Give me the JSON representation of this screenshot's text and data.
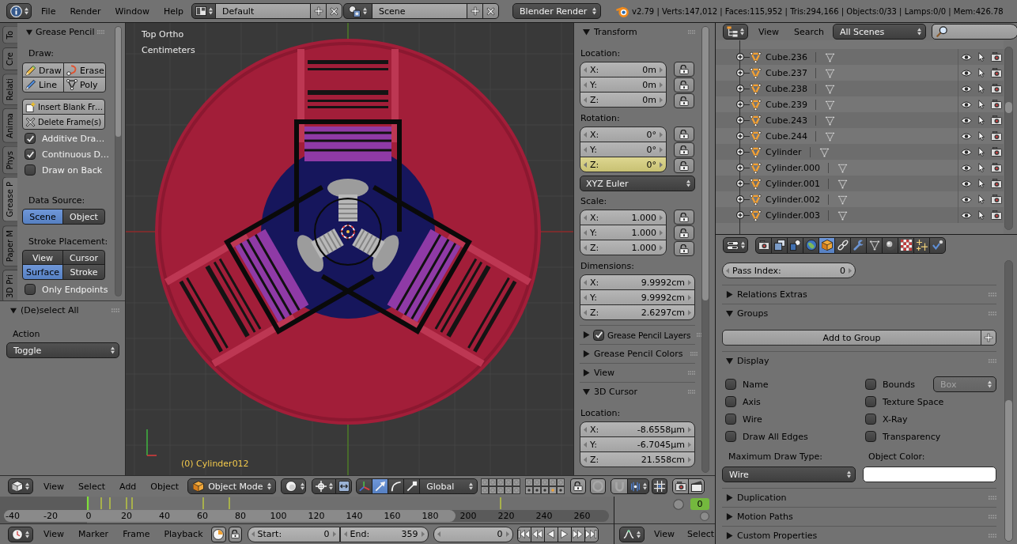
{
  "info_header": {
    "menus": [
      "File",
      "Render",
      "Window",
      "Help"
    ],
    "screen_layout": "Default",
    "scene": "Scene",
    "render_engine": "Blender Render",
    "stats": "v2.79 | Verts:147,012 | Faces:115,952 | Tris:294,166 | Objects:0/33 | Lamps:0/0 | Mem:426.78"
  },
  "tool_shelf": {
    "tabs": [
      {
        "label": "To",
        "selected": false
      },
      {
        "label": "Cre",
        "selected": false
      },
      {
        "label": "Relati",
        "selected": false
      },
      {
        "label": "Anima",
        "selected": false
      },
      {
        "label": "Phys",
        "selected": false
      },
      {
        "label": "Grease P",
        "selected": true
      },
      {
        "label": "Paper M",
        "selected": false
      },
      {
        "label": "3D Pri",
        "selected": false
      }
    ],
    "panel": {
      "title": "Grease Pencil",
      "expanded": true,
      "draw_label": "Draw:",
      "draw_tools": [
        {
          "kind": "draw",
          "label": "Draw"
        },
        {
          "kind": "erase",
          "label": "Erase"
        },
        {
          "kind": "line",
          "label": "Line"
        },
        {
          "kind": "poly",
          "label": "Poly"
        }
      ],
      "frame_actions": [
        {
          "kind": "insert",
          "label": "Insert Blank Fr…"
        },
        {
          "kind": "delete",
          "label": "Delete Frame(s)"
        }
      ],
      "options": [
        {
          "label": "Additive Dra…",
          "checked": true
        },
        {
          "label": "Continuous D…",
          "checked": true
        },
        {
          "label": "Draw on Back",
          "checked": false
        }
      ],
      "data_source": {
        "label": "Data Source:",
        "options": [
          {
            "label": "Scene",
            "selected": true
          },
          {
            "label": "Object",
            "selected": false
          }
        ]
      },
      "stroke_placement": {
        "label": "Stroke Placement:",
        "options": [
          {
            "label": "View",
            "selected": false
          },
          {
            "label": "Cursor",
            "selected": false
          },
          {
            "label": "Surface",
            "selected": true
          },
          {
            "label": "Stroke",
            "selected": false
          }
        ]
      },
      "only_endpoints": {
        "label": "Only Endpoints",
        "checked": false
      }
    }
  },
  "redo_panel": {
    "title": "(De)select All",
    "expanded": true,
    "action_label": "Action",
    "action": "Toggle"
  },
  "viewport": {
    "view": "Top Ortho",
    "units": "Centimeters",
    "active_object": "(0) Cylinder012"
  },
  "n_panel": {
    "panels": [
      {
        "kind": "fields",
        "title": "Transform",
        "expanded": true,
        "groups": [
          {
            "label": "Location:",
            "locks": true,
            "fields": [
              {
                "axis": "X:",
                "value": "0m"
              },
              {
                "axis": "Y:",
                "value": "0m"
              },
              {
                "axis": "Z:",
                "value": "0m"
              }
            ]
          },
          {
            "label": "Rotation:",
            "locks": true,
            "fields": [
              {
                "axis": "X:",
                "value": "0°",
                "keyframed": false
              },
              {
                "axis": "Y:",
                "value": "0°",
                "keyframed": false
              },
              {
                "axis": "Z:",
                "value": "0°",
                "keyframed": true
              }
            ],
            "mode": "XYZ Euler"
          },
          {
            "label": "Scale:",
            "locks": true,
            "fields": [
              {
                "axis": "X:",
                "value": "1.000"
              },
              {
                "axis": "Y:",
                "value": "1.000"
              },
              {
                "axis": "Z:",
                "value": "1.000"
              }
            ]
          },
          {
            "label": "Dimensions:",
            "locks": false,
            "fields": [
              {
                "axis": "X:",
                "value": "9.9992cm"
              },
              {
                "axis": "Y:",
                "value": "9.9992cm"
              },
              {
                "axis": "Z:",
                "value": "2.6297cm"
              }
            ]
          }
        ]
      },
      {
        "kind": "toggle",
        "title": "Grease Pencil Layers",
        "expanded": false,
        "checked": true
      },
      {
        "kind": "plain",
        "title": "Grease Pencil Colors",
        "expanded": false
      },
      {
        "kind": "plain",
        "title": "View",
        "expanded": false
      },
      {
        "kind": "fields",
        "title": "3D Cursor",
        "expanded": true,
        "groups": [
          {
            "label": "Location:",
            "locks": false,
            "fields": [
              {
                "axis": "X:",
                "value": "-8.6558µm"
              },
              {
                "axis": "Y:",
                "value": "-6.7045µm"
              },
              {
                "axis": "Z:",
                "value": "21.558cm"
              }
            ]
          }
        ]
      }
    ]
  },
  "outliner": {
    "menus": [
      "View",
      "Search"
    ],
    "filter": "All Scenes",
    "rows": [
      {
        "name": "Cube.236"
      },
      {
        "name": "Cube.237"
      },
      {
        "name": "Cube.238"
      },
      {
        "name": "Cube.239"
      },
      {
        "name": "Cube.243"
      },
      {
        "name": "Cube.244"
      },
      {
        "name": "Cylinder"
      },
      {
        "name": "Cylinder.000"
      },
      {
        "name": "Cylinder.001"
      },
      {
        "name": "Cylinder.002"
      },
      {
        "name": "Cylinder.003"
      }
    ]
  },
  "properties": {
    "tabs": [
      {
        "kind": "render",
        "selected": false
      },
      {
        "kind": "render_layers",
        "selected": false
      },
      {
        "kind": "scene",
        "selected": false
      },
      {
        "kind": "world",
        "selected": false
      },
      {
        "kind": "object",
        "selected": true
      },
      {
        "kind": "constraints",
        "selected": false
      },
      {
        "kind": "modifiers",
        "selected": false
      },
      {
        "kind": "data",
        "selected": false
      },
      {
        "kind": "material",
        "selected": false
      },
      {
        "kind": "texture",
        "selected": false
      },
      {
        "kind": "particles",
        "selected": false
      },
      {
        "kind": "physics",
        "selected": false
      }
    ],
    "pass_index": {
      "label": "Pass Index:",
      "value": "0"
    },
    "panels": [
      {
        "title": "Relations Extras",
        "expanded": false
      },
      {
        "title": "Groups",
        "expanded": true,
        "button": "Add to Group"
      },
      {
        "title": "Display",
        "expanded": true,
        "display": {
          "left_options": [
            {
              "label": "Name",
              "checked": false
            },
            {
              "label": "Axis",
              "checked": false
            },
            {
              "label": "Wire",
              "checked": false
            },
            {
              "label": "Draw All Edges",
              "checked": false
            }
          ],
          "right_options": [
            {
              "label": "Bounds",
              "checked": false
            },
            {
              "label": "Texture Space",
              "checked": false
            },
            {
              "label": "X-Ray",
              "checked": false
            },
            {
              "label": "Transparency",
              "checked": false
            }
          ],
          "bounds_type": {
            "value": "Box",
            "disabled": true
          },
          "max_draw_type": {
            "label": "Maximum Draw Type:",
            "value": "Wire"
          },
          "object_color": {
            "label": "Object Color:",
            "color": "#ffffff"
          }
        }
      },
      {
        "title": "Duplication",
        "expanded": false
      },
      {
        "title": "Motion Paths",
        "expanded": false
      },
      {
        "title": "Custom Properties",
        "expanded": false
      }
    ]
  },
  "view3d_header": {
    "menus": [
      "View",
      "Select",
      "Add",
      "Object"
    ],
    "mode": "Object Mode",
    "manipulators": [
      {
        "kind": "translate",
        "selected": true
      },
      {
        "kind": "rotate",
        "selected": false
      },
      {
        "kind": "scale",
        "selected": false
      }
    ],
    "orientation": "Global"
  },
  "timeline": {
    "frame_labels": [
      "-40",
      "-20",
      "0",
      "20",
      "40",
      "60",
      "80",
      "100",
      "120",
      "140",
      "160",
      "180",
      "200",
      "220",
      "240",
      "260"
    ]
  },
  "timeline_header": {
    "menus": [
      "View",
      "Marker",
      "Frame",
      "Playback"
    ],
    "start": {
      "label": "Start:",
      "value": "0"
    },
    "end": {
      "label": "End:",
      "value": "359"
    },
    "current_frame": "0"
  },
  "graph_editor": {
    "field": {
      "value": "0",
      "animated": true
    },
    "menus": [
      "View",
      "Select"
    ]
  }
}
